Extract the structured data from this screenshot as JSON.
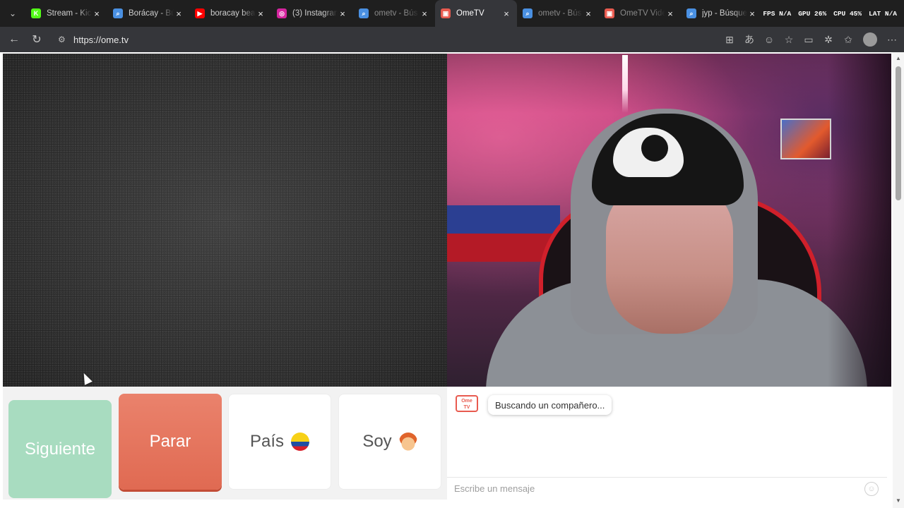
{
  "browser": {
    "tabs": [
      {
        "title": "Stream - Kic",
        "icon": "kick-icon",
        "color": "#53fc18",
        "glyph": "K"
      },
      {
        "title": "Borácay - Bú",
        "icon": "search-icon",
        "color": "#4a90e2",
        "glyph": "⌕"
      },
      {
        "title": "boracay bea",
        "icon": "youtube-icon",
        "color": "#ff0000",
        "glyph": "▶"
      },
      {
        "title": "(3) Instagran",
        "icon": "instagram-icon",
        "color": "#d6249f",
        "glyph": "◎"
      },
      {
        "title": "ometv - Bús",
        "icon": "search-icon",
        "color": "#4a90e2",
        "glyph": "⌕"
      },
      {
        "title": "OmeTV",
        "icon": "ometv-icon",
        "color": "#e85a4f",
        "glyph": "▣"
      },
      {
        "title": "ometv - Bús",
        "icon": "search-icon",
        "color": "#4a90e2",
        "glyph": "⌕"
      },
      {
        "title": "OmeTV Vide",
        "icon": "ometv-icon",
        "color": "#e85a4f",
        "glyph": "▣"
      },
      {
        "title": "jyp - Búsque",
        "icon": "search-icon",
        "color": "#4a90e2",
        "glyph": "⌕"
      }
    ],
    "active_tab": 5,
    "url": "https://ome.tv",
    "overlay": {
      "fps": "FPS N/A",
      "gpu": "GPU 26%",
      "cpu": "CPU 45%",
      "lat": "LAT N/A"
    }
  },
  "controls": {
    "next_label": "Siguiente",
    "stop_label": "Parar",
    "country_label": "País",
    "gender_label": "Soy"
  },
  "chat": {
    "logo_text_1": "Ome",
    "logo_text_2": "TV",
    "status_message": "Buscando un compañero...",
    "input_placeholder": "Escribe un mensaje"
  }
}
